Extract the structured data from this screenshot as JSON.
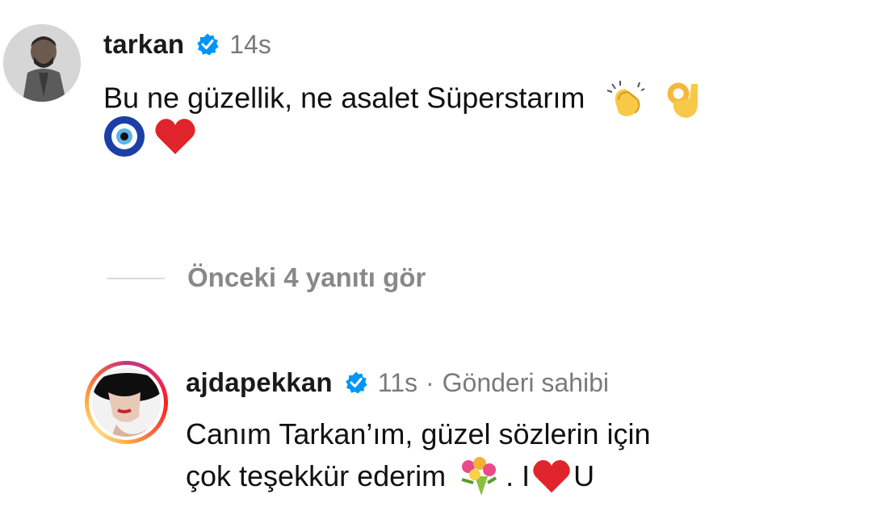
{
  "comment1": {
    "username": "tarkan",
    "time": "14s",
    "text_line1": "Bu ne güzellik, ne asalet Süperstarım",
    "emojis_line1": [
      "clapping-hands-emoji",
      "ok-hand-emoji"
    ],
    "emojis_line2": [
      "nazar-amulet-emoji",
      "red-heart-emoji"
    ]
  },
  "replies_toggle": {
    "label": "Önceki 4 yanıtı gör"
  },
  "comment2": {
    "username": "ajdapekkan",
    "time": "11s",
    "separator": "·",
    "owner_label": "Gönderi sahibi",
    "text_line1": "Canım Tarkan’ım, güzel sözlerin için",
    "text_line2_a": "çok teşekkür ederim",
    "text_line2_b": ". I",
    "text_line2_c": "U",
    "emojis_line2": [
      "bouquet-emoji",
      "red-heart-emoji"
    ]
  },
  "colors": {
    "verified_blue": "#0095f6",
    "secondary_text": "#7a7a7a",
    "heart_red": "#e0242c"
  }
}
